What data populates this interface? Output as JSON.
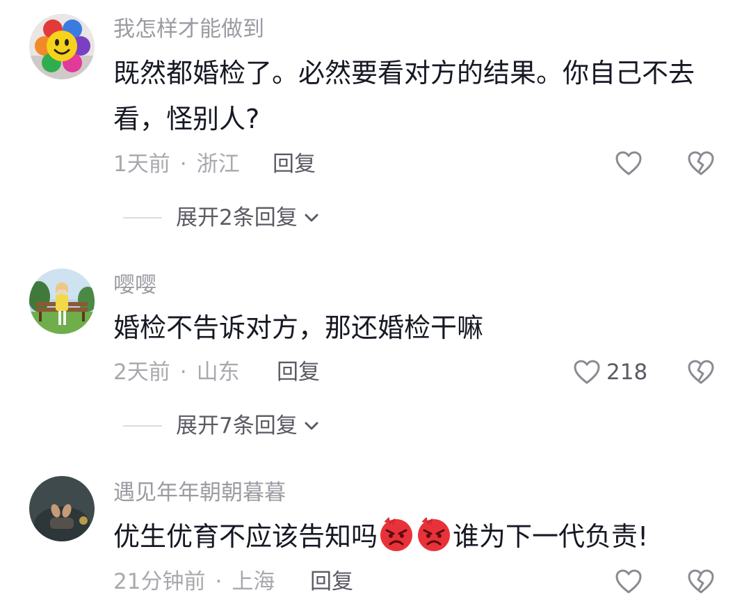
{
  "comments": [
    {
      "username": "我怎样才能做到",
      "text": "既然都婚检了。必然要看对方的结果。你自己不去看，怪别人?",
      "time": "1天前",
      "location": "浙江",
      "reply_label": "回复",
      "likes": "",
      "expand_label": "展开2条回复",
      "avatar_icon": "rainbow-smiley-avatar"
    },
    {
      "username": "嘤嘤",
      "text": "婚检不告诉对方，那还婚检干嘛",
      "time": "2天前",
      "location": "山东",
      "reply_label": "回复",
      "likes": "218",
      "expand_label": "展开7条回复",
      "avatar_icon": "girl-on-bench-avatar"
    },
    {
      "username": "遇见年年朝朝暮暮",
      "text_before": "优生优育不应该告知吗",
      "text_after": "谁为下一代负责!",
      "emojis": [
        "angry-face-emoji",
        "angry-face-emoji"
      ],
      "time": "21分钟前",
      "location": "上海",
      "reply_label": "回复",
      "likes": "",
      "avatar_icon": "dark-photo-avatar"
    }
  ],
  "meta_separator": "·",
  "icons": {
    "like": "heart-outline-icon",
    "dislike": "broken-heart-outline-icon",
    "expand": "chevron-down-icon"
  },
  "colors": {
    "username": "#9b9ba3",
    "text": "#161823",
    "meta": "#a8a8ae",
    "action": "#5a5a63",
    "emoji_red": "#e8323a"
  }
}
